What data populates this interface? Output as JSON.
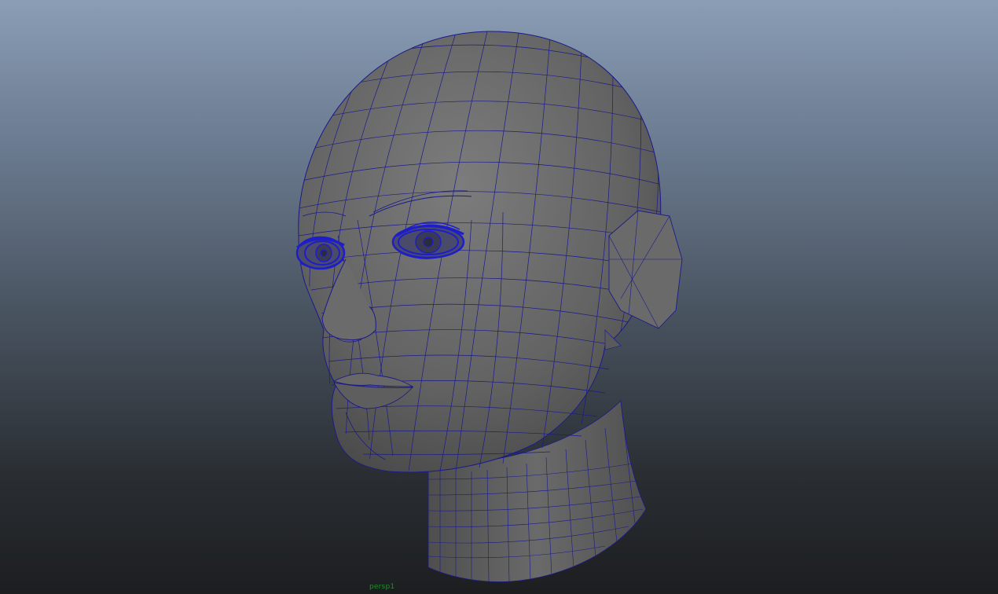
{
  "viewport": {
    "camera_label": "persp1"
  },
  "colors": {
    "background_top": "#8a9db5",
    "background_bottom": "#1c1e20",
    "mesh_shading": "#6e6e6e",
    "wireframe": "#1a1a8c",
    "eye_wireframe": "#1e1ec8",
    "camera_label": "#1f8f2a"
  },
  "scene": {
    "object": "head-mesh",
    "display_mode": "wireframe-on-shaded"
  }
}
